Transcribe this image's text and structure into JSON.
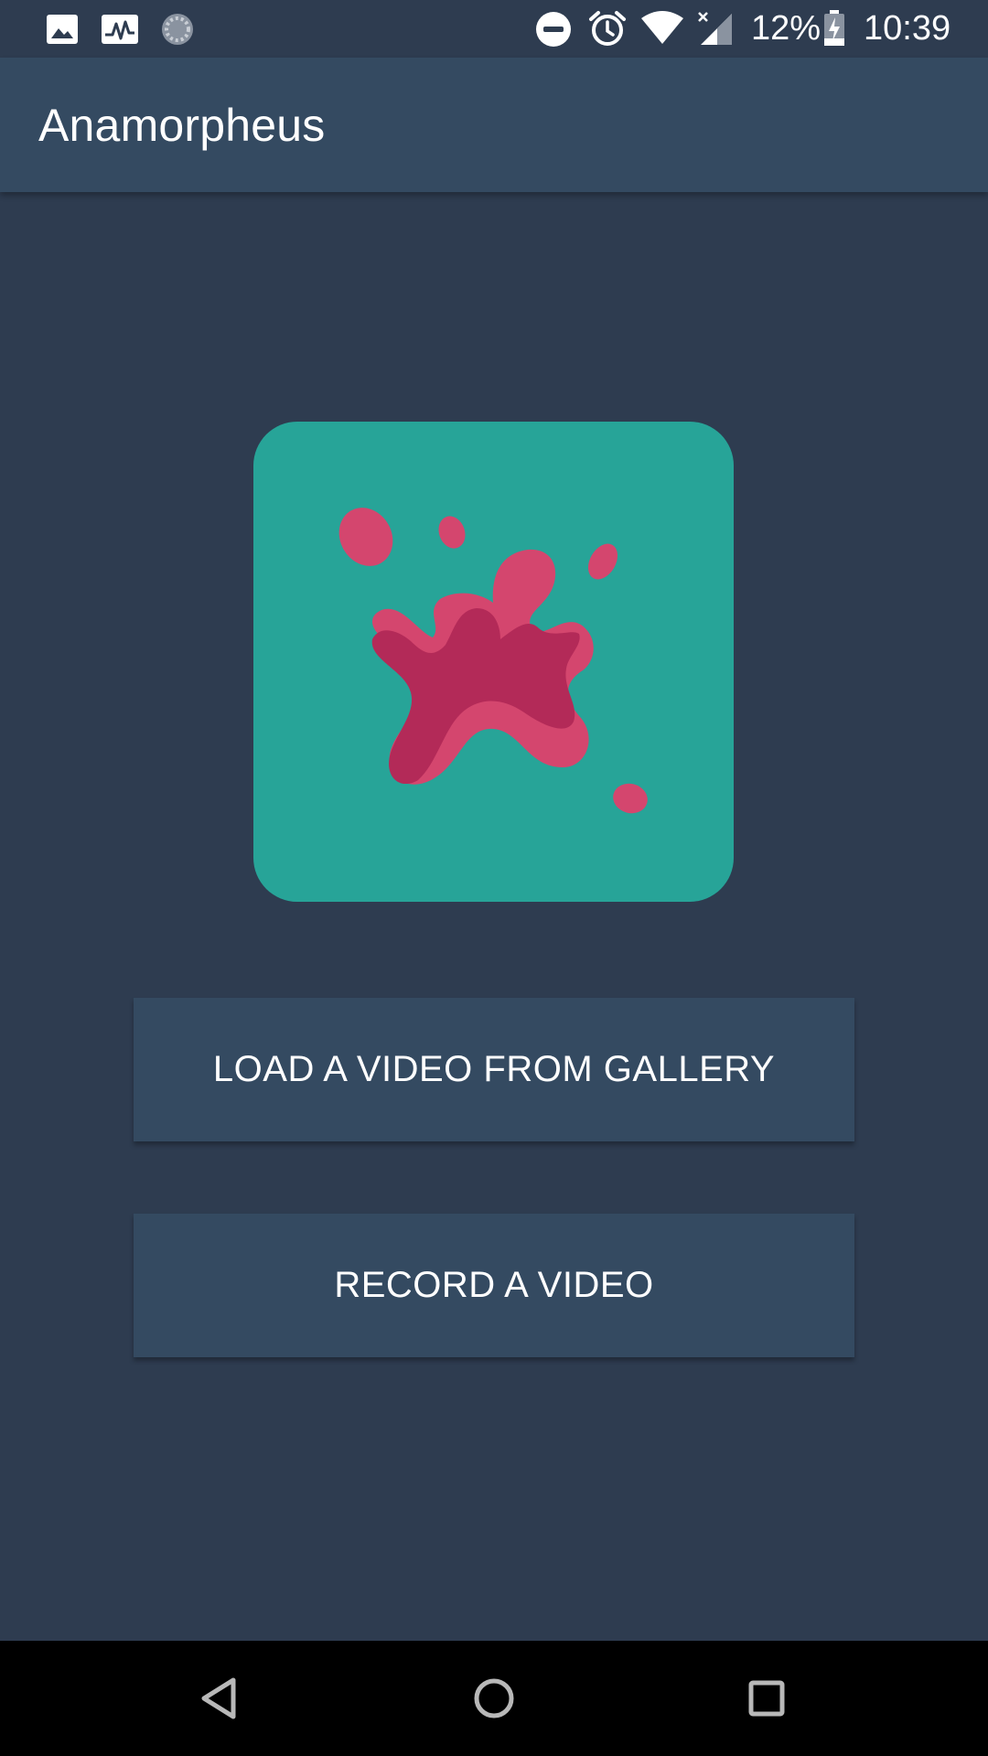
{
  "status_bar": {
    "notification_icons": [
      "image-icon",
      "activity-chart-icon",
      "sync-spinner-icon"
    ],
    "system_icons": [
      "do-not-disturb-icon",
      "alarm-icon",
      "wifi-icon",
      "cellular-no-data-icon"
    ],
    "battery_percent": "12%",
    "battery_icon": "battery-charging-icon",
    "time": "10:39"
  },
  "app_bar": {
    "title": "Anamorpheus"
  },
  "logo": {
    "icon": "paint-splash-logo",
    "background_color": "#27a498",
    "splash_light_color": "#d4466e",
    "splash_dark_color": "#b32a58"
  },
  "actions": {
    "load_gallery_label": "LOAD A VIDEO FROM GALLERY",
    "record_label": "RECORD A VIDEO"
  },
  "nav_bar": {
    "back_icon": "back-triangle-icon",
    "home_icon": "home-circle-icon",
    "recents_icon": "recents-square-icon"
  },
  "colors": {
    "background": "#2e3c50",
    "app_bar": "#344a61",
    "button": "#344a61",
    "text": "#ffffff"
  }
}
